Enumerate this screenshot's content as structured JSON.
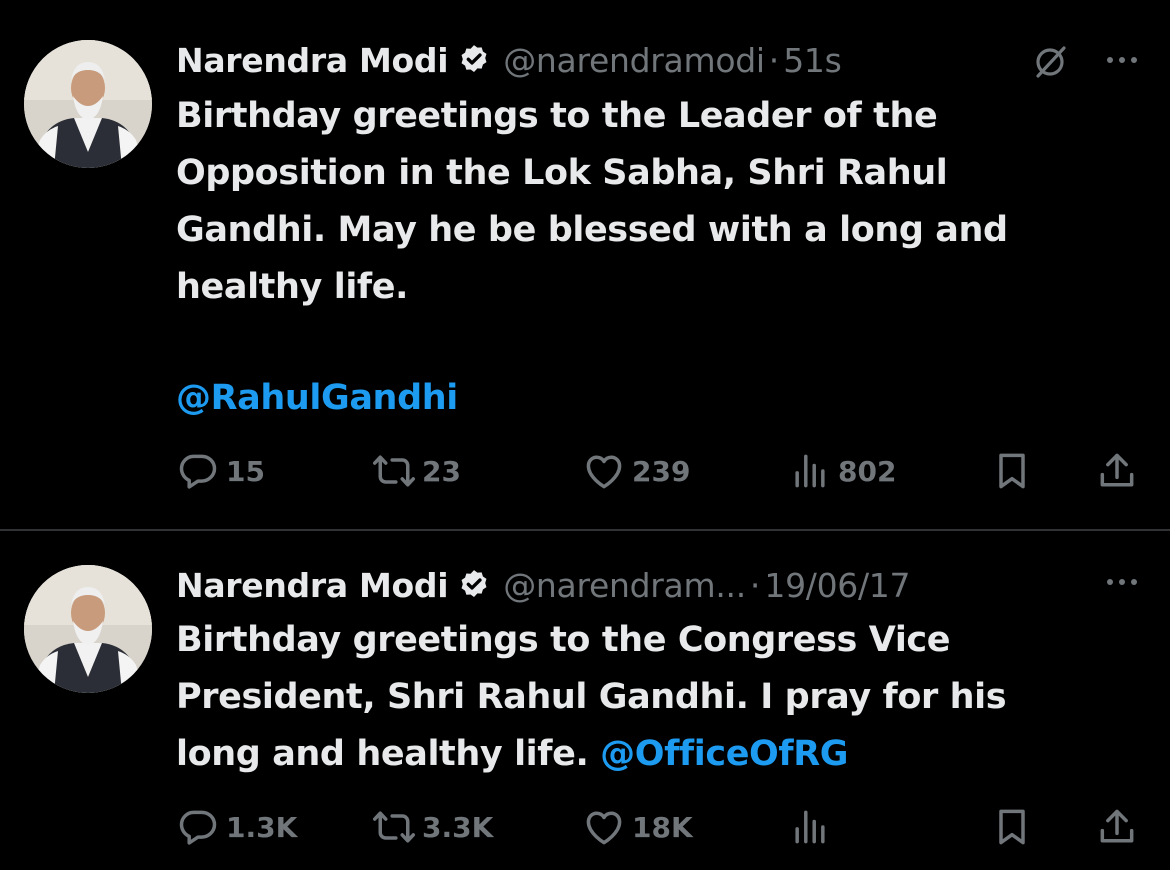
{
  "tweets": [
    {
      "name": "Narendra Modi",
      "handle": "@narendramodi",
      "separator": "·",
      "time": "51s",
      "text": "Birthday greetings to the Leader of the\nOpposition in the Lok Sabha, Shri Rahul\nGandhi. May he be blessed with a long and\nhealthy life.",
      "mention": "@RahulGandhi",
      "replies": "15",
      "reposts": "23",
      "likes": "239",
      "views": "802"
    },
    {
      "name": "Narendra Modi",
      "handle": "@narendram...",
      "separator": "·",
      "time": "19/06/17",
      "text_main": "Birthday greetings to the Congress Vice\nPresident, Shri Rahul Gandhi. I pray for his\nlong and healthy life. ",
      "text_mention": "@OfficeOfRG",
      "replies": "1.3K",
      "reposts": "3.3K",
      "likes": "18K",
      "views": ""
    }
  ],
  "icons": {
    "verified": "verified-badge-icon",
    "grok": "grok-icon",
    "more": "more-icon",
    "reply": "reply-icon",
    "repost": "repost-icon",
    "like": "heart-icon",
    "views": "views-icon",
    "bookmark": "bookmark-icon",
    "share": "share-icon"
  },
  "colors": {
    "background": "#000000",
    "text": "#e7e9ea",
    "secondary": "#71767b",
    "link": "#1d9bf0",
    "divider": "#2f3336",
    "verified_badge": "#e7e9ea"
  }
}
